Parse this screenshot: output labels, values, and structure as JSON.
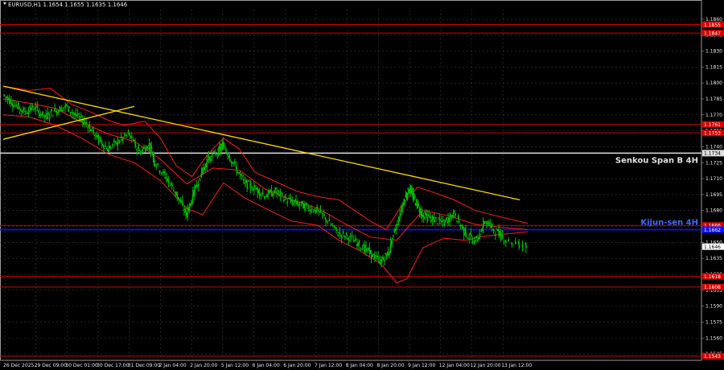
{
  "header": {
    "symbol": "EURUSD,H1",
    "ohlc": "1.1654 1.1655 1.1635 1.1646"
  },
  "colors": {
    "background": "#000000",
    "grid": "#3a3a3a",
    "candle": "#00c000",
    "ichimoku": "#ff1a1a",
    "level": "#d40000",
    "trendline": "#ffd700",
    "senkou": "#e0e0e0",
    "kijun": "#1010ff",
    "axis_text": "#e6e6e6"
  },
  "chart_data": {
    "type": "line",
    "price_axis": {
      "ticks": [
        1.186,
        1.1845,
        1.183,
        1.1815,
        1.18,
        1.1785,
        1.177,
        1.1755,
        1.174,
        1.1725,
        1.171,
        1.1695,
        1.168,
        1.1665,
        1.165,
        1.1635,
        1.162,
        1.1605,
        1.159,
        1.1575,
        1.156,
        1.1545
      ],
      "ylim": [
        1.1539,
        1.1869
      ]
    },
    "time_axis": {
      "ticks": [
        "26 Dec 2025",
        "29 Dec 09:00",
        "30 Dec 01:00",
        "30 Dec 17:00",
        "31 Dec 09:00",
        "2 Jan 04:00",
        "2 Jan 20:00",
        "5 Jan 12:00",
        "6 Jan 04:00",
        "6 Jan 20:00",
        "7 Jan 12:00",
        "8 Jan 04:00",
        "8 Jan 20:00",
        "9 Jan 12:00",
        "12 Jan 04:00",
        "12 Jan 20:00",
        "13 Jan 12:00"
      ]
    },
    "horizontal_levels": [
      {
        "value": 1.1855,
        "label": "1.1855",
        "role": "level"
      },
      {
        "value": 1.1847,
        "label": "1.1847",
        "role": "level"
      },
      {
        "value": 1.1761,
        "label": "1.1761",
        "role": "level"
      },
      {
        "value": 1.1753,
        "label": "1.1753",
        "role": "level"
      },
      {
        "value": 1.1734,
        "label": "1.1734",
        "role": "senkou"
      },
      {
        "value": 1.1666,
        "label": "1.1666",
        "role": "level"
      },
      {
        "value": 1.1662,
        "label": "1.1662",
        "role": "kijun"
      },
      {
        "value": 1.1618,
        "label": "1.1618",
        "role": "level"
      },
      {
        "value": 1.1608,
        "label": "1.1608",
        "role": "level"
      },
      {
        "value": 1.1543,
        "label": "1.1543",
        "role": "level"
      }
    ],
    "level_labels": {
      "senkou": "Senkou Span B 4H",
      "kijun": "Kijun-sen 4H"
    },
    "current_price": {
      "value": 1.1646,
      "label": "1.1646"
    },
    "price_path": [
      [
        0.0,
        1.1789
      ],
      [
        0.02,
        1.1781
      ],
      [
        0.04,
        1.1773
      ],
      [
        0.06,
        1.1777
      ],
      [
        0.08,
        1.1768
      ],
      [
        0.1,
        1.1774
      ],
      [
        0.12,
        1.1778
      ],
      [
        0.14,
        1.1769
      ],
      [
        0.16,
        1.1762
      ],
      [
        0.18,
        1.1748
      ],
      [
        0.2,
        1.1738
      ],
      [
        0.22,
        1.1745
      ],
      [
        0.24,
        1.1752
      ],
      [
        0.26,
        1.1735
      ],
      [
        0.28,
        1.1742
      ],
      [
        0.29,
        1.1725
      ],
      [
        0.31,
        1.1712
      ],
      [
        0.33,
        1.1696
      ],
      [
        0.35,
        1.1676
      ],
      [
        0.37,
        1.1705
      ],
      [
        0.39,
        1.1728
      ],
      [
        0.41,
        1.1735
      ],
      [
        0.42,
        1.1742
      ],
      [
        0.44,
        1.1724
      ],
      [
        0.46,
        1.1706
      ],
      [
        0.48,
        1.1701
      ],
      [
        0.5,
        1.1694
      ],
      [
        0.52,
        1.1698
      ],
      [
        0.54,
        1.169
      ],
      [
        0.56,
        1.1687
      ],
      [
        0.58,
        1.1683
      ],
      [
        0.6,
        1.168
      ],
      [
        0.62,
        1.167
      ],
      [
        0.64,
        1.1658
      ],
      [
        0.66,
        1.1655
      ],
      [
        0.68,
        1.1648
      ],
      [
        0.7,
        1.164
      ],
      [
        0.72,
        1.1632
      ],
      [
        0.735,
        1.164
      ],
      [
        0.75,
        1.1665
      ],
      [
        0.765,
        1.169
      ],
      [
        0.775,
        1.1701
      ],
      [
        0.785,
        1.169
      ],
      [
        0.8,
        1.1676
      ],
      [
        0.82,
        1.1672
      ],
      [
        0.84,
        1.1668
      ],
      [
        0.86,
        1.1677
      ],
      [
        0.88,
        1.166
      ],
      [
        0.9,
        1.165
      ],
      [
        0.92,
        1.167
      ],
      [
        0.94,
        1.166
      ],
      [
        0.96,
        1.1652
      ],
      [
        1.0,
        1.1646
      ]
    ],
    "ichimoku_upper": [
      [
        0.0,
        1.1797
      ],
      [
        0.05,
        1.1793
      ],
      [
        0.09,
        1.1795
      ],
      [
        0.13,
        1.178
      ],
      [
        0.17,
        1.1772
      ],
      [
        0.2,
        1.1765
      ],
      [
        0.23,
        1.176
      ],
      [
        0.27,
        1.1764
      ],
      [
        0.3,
        1.1748
      ],
      [
        0.33,
        1.1722
      ],
      [
        0.36,
        1.1712
      ],
      [
        0.39,
        1.1733
      ],
      [
        0.42,
        1.1748
      ],
      [
        0.45,
        1.1738
      ],
      [
        0.48,
        1.1716
      ],
      [
        0.52,
        1.1707
      ],
      [
        0.56,
        1.1698
      ],
      [
        0.6,
        1.1693
      ],
      [
        0.64,
        1.169
      ],
      [
        0.67,
        1.168
      ],
      [
        0.7,
        1.167
      ],
      [
        0.73,
        1.1662
      ],
      [
        0.76,
        1.1685
      ],
      [
        0.79,
        1.1702
      ],
      [
        0.82,
        1.1697
      ],
      [
        0.86,
        1.169
      ],
      [
        0.9,
        1.168
      ],
      [
        0.94,
        1.1675
      ],
      [
        1.0,
        1.1668
      ]
    ],
    "ichimoku_mid": [
      [
        0.0,
        1.1785
      ],
      [
        0.05,
        1.1781
      ],
      [
        0.1,
        1.1776
      ],
      [
        0.15,
        1.1763
      ],
      [
        0.2,
        1.1752
      ],
      [
        0.25,
        1.1745
      ],
      [
        0.3,
        1.1728
      ],
      [
        0.35,
        1.1705
      ],
      [
        0.4,
        1.172
      ],
      [
        0.45,
        1.1718
      ],
      [
        0.5,
        1.17
      ],
      [
        0.55,
        1.169
      ],
      [
        0.6,
        1.1682
      ],
      [
        0.65,
        1.1668
      ],
      [
        0.7,
        1.1655
      ],
      [
        0.75,
        1.1652
      ],
      [
        0.8,
        1.168
      ],
      [
        0.85,
        1.1675
      ],
      [
        0.9,
        1.1667
      ],
      [
        0.95,
        1.1664
      ],
      [
        1.0,
        1.1662
      ]
    ],
    "ichimoku_lower": [
      [
        0.0,
        1.177
      ],
      [
        0.05,
        1.1768
      ],
      [
        0.1,
        1.176
      ],
      [
        0.15,
        1.1748
      ],
      [
        0.2,
        1.1733
      ],
      [
        0.25,
        1.1725
      ],
      [
        0.3,
        1.1708
      ],
      [
        0.35,
        1.1682
      ],
      [
        0.38,
        1.1676
      ],
      [
        0.42,
        1.1706
      ],
      [
        0.46,
        1.1692
      ],
      [
        0.5,
        1.1682
      ],
      [
        0.55,
        1.167
      ],
      [
        0.6,
        1.1666
      ],
      [
        0.64,
        1.1652
      ],
      [
        0.68,
        1.1642
      ],
      [
        0.72,
        1.163
      ],
      [
        0.75,
        1.1612
      ],
      [
        0.77,
        1.1616
      ],
      [
        0.8,
        1.1645
      ],
      [
        0.84,
        1.1654
      ],
      [
        0.88,
        1.1652
      ],
      [
        0.92,
        1.1656
      ],
      [
        1.0,
        1.166
      ]
    ],
    "trendlines": [
      {
        "from": [
          0.0,
          1.1797
        ],
        "to": [
          0.985,
          1.169
        ]
      },
      {
        "from": [
          0.0,
          1.1747
        ],
        "to": [
          0.25,
          1.1778
        ]
      }
    ]
  }
}
